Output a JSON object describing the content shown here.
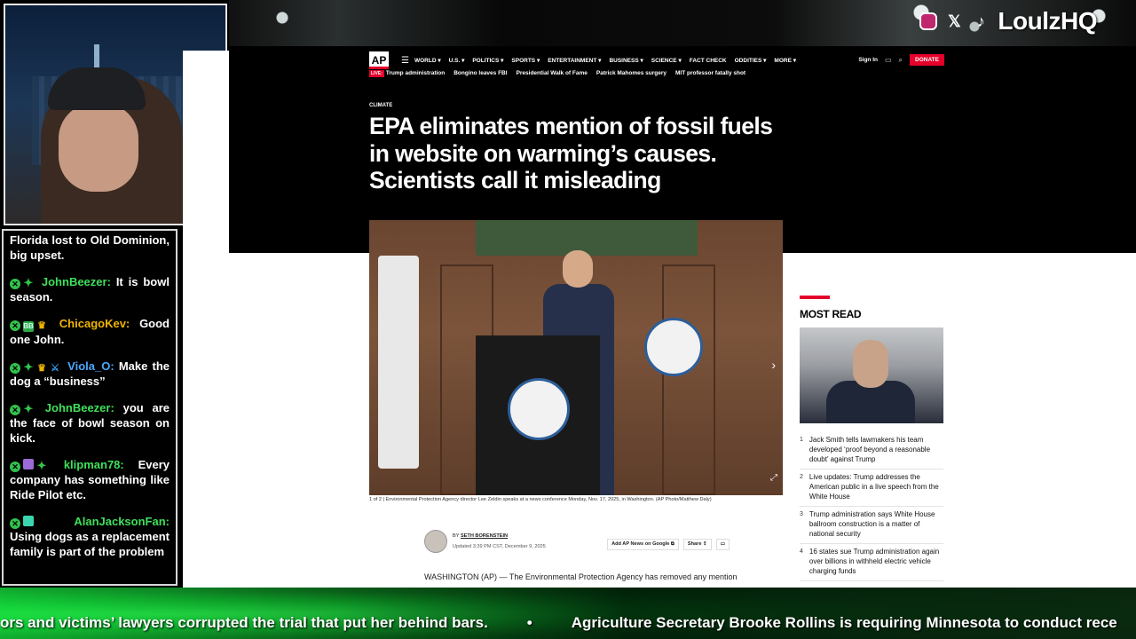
{
  "social": {
    "icons": [
      "instagram-icon",
      "x-icon",
      "tiktok-icon"
    ],
    "handle": "LoulzHQ"
  },
  "chat": {
    "messages": [
      {
        "user": "",
        "text": "Florida lost to Old Dominion, big upset.",
        "badges": []
      },
      {
        "user": "JohnBeezer:",
        "text": "It is bowl season.",
        "badges": [
          "x",
          "diamond"
        ],
        "color": "#3ee05a"
      },
      {
        "user": "ChicagoKev:",
        "text": "Good one John.",
        "badges": [
          "x",
          "bb",
          "crown"
        ],
        "color": "#f0b400"
      },
      {
        "user": "Viola_O:",
        "text": "Make the dog a “business”",
        "badges": [
          "x",
          "diamond",
          "crown",
          "sword"
        ],
        "color": "#4aa8ff"
      },
      {
        "user": "JohnBeezer:",
        "text": "you are the face of bowl season on kick.",
        "badges": [
          "x",
          "diamond"
        ],
        "color": "#3ee05a"
      },
      {
        "user": "klipman78:",
        "text": "Every company has something like Ride Pilot etc.",
        "badges": [
          "x",
          "purple",
          "diamond"
        ],
        "color": "#3ee05a"
      },
      {
        "user": "AlanJacksonFan:",
        "text": "Using dogs as a replacement family is part of the problem",
        "badges": [
          "x",
          "teal"
        ],
        "color": "#3ee05a"
      }
    ]
  },
  "ap": {
    "logo": "AP",
    "nav": [
      "WORLD",
      "U.S.",
      "POLITICS",
      "SPORTS",
      "ENTERTAINMENT",
      "BUSINESS",
      "SCIENCE",
      "FACT CHECK",
      "ODDITIES",
      "MORE"
    ],
    "sign_in": "Sign In",
    "donate": "DONATE",
    "live": "LIVE:",
    "trending": [
      "Trump administration",
      "Bongino leaves FBI",
      "Presidential Walk of Fame",
      "Patrick Mahomes surgery",
      "MIT professor fatally shot"
    ],
    "kicker": "CLIMATE",
    "headline": "EPA eliminates mention of fossil fuels in website on warming’s causes. Scientists call it misleading",
    "caption": "1 of 2 | Environmental Protection Agency director Lee Zeldin speaks at a news conference Monday, Nov. 17, 2025, in Washington. (AP Photo/Matthew Daly)",
    "byline_prefix": "BY",
    "author": "SETH BORENSTEIN",
    "updated": "Updated 3:39 PM CST, December 9, 2025",
    "btn_google": "Add AP News on Google",
    "btn_share": "Share",
    "dateline": "WASHINGTON (AP) — The Environmental Protection Agency has removed any mention",
    "most_read_title": "MOST READ",
    "most_read": [
      {
        "n": "1",
        "t": "Jack Smith tells lawmakers his team developed ‘proof beyond a reasonable doubt’ against Trump"
      },
      {
        "n": "2",
        "t": "Live updates: Trump addresses the American public in a live speech from the White House"
      },
      {
        "n": "3",
        "t": "Trump administration says White House ballroom construction is a matter of national security"
      },
      {
        "n": "4",
        "t": "16 states sue Trump administration again over billions in withheld electric vehicle charging funds"
      }
    ]
  },
  "ticker": {
    "item1": "ors and victims’ lawyers corrupted the trial that put her behind bars.",
    "separator": "•",
    "item2": "Agriculture Secretary Brooke Rollins is requiring Minnesota to conduct rece"
  }
}
